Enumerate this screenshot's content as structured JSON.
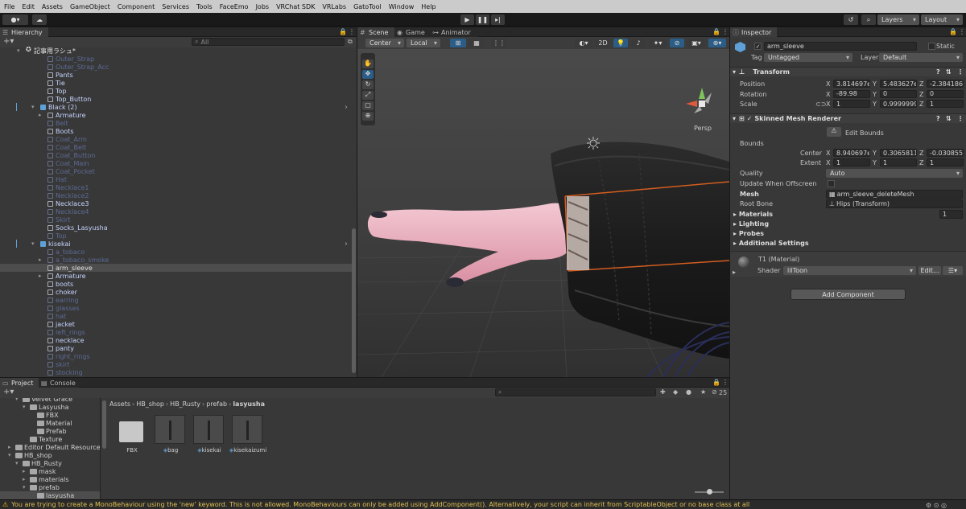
{
  "menu": [
    "File",
    "Edit",
    "Assets",
    "GameObject",
    "Component",
    "Services",
    "Tools",
    "FaceEmo",
    "Jobs",
    "VRChat SDK",
    "VRLabs",
    "GatoTool",
    "Window",
    "Help"
  ],
  "toolbar": {
    "account_label": "",
    "cloud_icon": "cloud-icon",
    "layers": "Layers",
    "layout": "Layout"
  },
  "hierarchy": {
    "tab": "Hierarchy",
    "search_placeholder": "All",
    "rows": [
      {
        "label": "記事用ラシュ*",
        "depth": 0,
        "style": "white",
        "arrow": "▾",
        "icon": "scene"
      },
      {
        "label": "Outer_Strap",
        "depth": 3,
        "style": "dim"
      },
      {
        "label": "Outer_Strap_Acc",
        "depth": 3,
        "style": "dim"
      },
      {
        "label": "Pants",
        "depth": 3,
        "style": "on"
      },
      {
        "label": "Tie",
        "depth": 3,
        "style": "on"
      },
      {
        "label": "Top",
        "depth": 3,
        "style": "on"
      },
      {
        "label": "Top_Button",
        "depth": 3,
        "style": "on"
      },
      {
        "label": "Black (2)",
        "depth": 2,
        "style": "on",
        "arrow": "▾",
        "prefab": true,
        "chevron": true
      },
      {
        "label": "Armature",
        "depth": 3,
        "style": "on",
        "arrow": "▸"
      },
      {
        "label": "Belt",
        "depth": 3,
        "style": "dim"
      },
      {
        "label": "Boots",
        "depth": 3,
        "style": "on"
      },
      {
        "label": "Coat_Arm",
        "depth": 3,
        "style": "dim"
      },
      {
        "label": "Coat_Belt",
        "depth": 3,
        "style": "dim"
      },
      {
        "label": "Coat_Button",
        "depth": 3,
        "style": "dim"
      },
      {
        "label": "Coat_Main",
        "depth": 3,
        "style": "dim"
      },
      {
        "label": "Coat_Pocket",
        "depth": 3,
        "style": "dim"
      },
      {
        "label": "Hat",
        "depth": 3,
        "style": "dim"
      },
      {
        "label": "Necklace1",
        "depth": 3,
        "style": "dim"
      },
      {
        "label": "Necklace2",
        "depth": 3,
        "style": "dim"
      },
      {
        "label": "Necklace3",
        "depth": 3,
        "style": "on"
      },
      {
        "label": "Necklace4",
        "depth": 3,
        "style": "dim"
      },
      {
        "label": "Skirt",
        "depth": 3,
        "style": "dim"
      },
      {
        "label": "Socks_Lasyusha",
        "depth": 3,
        "style": "on"
      },
      {
        "label": "Top",
        "depth": 3,
        "style": "dim"
      },
      {
        "label": "kisekai",
        "depth": 2,
        "style": "on",
        "arrow": "▾",
        "prefab": true,
        "chevron": true
      },
      {
        "label": "a_tobaco",
        "depth": 3,
        "style": "dim"
      },
      {
        "label": "a_tobaco_smoke",
        "depth": 3,
        "style": "dim",
        "arrow": "▸"
      },
      {
        "label": "arm_sleeve",
        "depth": 3,
        "style": "white",
        "selected": true
      },
      {
        "label": "Armature",
        "depth": 3,
        "style": "on",
        "arrow": "▸"
      },
      {
        "label": "boots",
        "depth": 3,
        "style": "on"
      },
      {
        "label": "choker",
        "depth": 3,
        "style": "on"
      },
      {
        "label": "earring",
        "depth": 3,
        "style": "dim"
      },
      {
        "label": "glasses",
        "depth": 3,
        "style": "dim"
      },
      {
        "label": "hat",
        "depth": 3,
        "style": "dim"
      },
      {
        "label": "jacket",
        "depth": 3,
        "style": "on"
      },
      {
        "label": "left_rings",
        "depth": 3,
        "style": "dim"
      },
      {
        "label": "necklace",
        "depth": 3,
        "style": "on"
      },
      {
        "label": "panty",
        "depth": 3,
        "style": "on"
      },
      {
        "label": "right_rings",
        "depth": 3,
        "style": "dim"
      },
      {
        "label": "skirt",
        "depth": 3,
        "style": "dim"
      },
      {
        "label": "stocking",
        "depth": 3,
        "style": "dim"
      }
    ]
  },
  "scene": {
    "tabs": [
      "Scene",
      "Game",
      "Animator"
    ],
    "pivot": "Center",
    "space": "Local",
    "mode_2d": "2D",
    "persp": "Persp",
    "gizmo_axes": [
      "x",
      "y",
      "z"
    ]
  },
  "inspector": {
    "tab": "Inspector",
    "object_name": "arm_sleeve",
    "static_label": "Static",
    "tag_label": "Tag",
    "tag_value": "Untagged",
    "layer_label": "Layer",
    "layer_value": "Default",
    "transform": {
      "title": "Transform",
      "rows": [
        {
          "label": "Position",
          "x": "3.814697e-",
          "y": "5.483627e-",
          "z": "-2.384186e"
        },
        {
          "label": "Rotation",
          "x": "-89.98",
          "y": "0",
          "z": "0"
        },
        {
          "label": "Scale",
          "x": "1",
          "y": "0.9999999",
          "z": "1"
        }
      ]
    },
    "smr": {
      "title": "Skinned Mesh Renderer",
      "edit_bounds": "Edit Bounds",
      "bounds_label": "Bounds",
      "center": {
        "label": "Center",
        "x": "8.940697e-",
        "y": "0.3065811",
        "z": "-0.0308554"
      },
      "extent": {
        "label": "Extent",
        "x": "1",
        "y": "1",
        "z": "1"
      },
      "quality_label": "Quality",
      "quality_value": "Auto",
      "offscreen_label": "Update When Offscreen",
      "mesh_label": "Mesh",
      "mesh_value": "arm_sleeve_deleteMesh",
      "rootbone_label": "Root Bone",
      "rootbone_value": "Hips (Transform)",
      "materials_label": "Materials",
      "materials_count": "1",
      "lighting_label": "Lighting",
      "probes_label": "Probes",
      "additional_label": "Additional Settings"
    },
    "material": {
      "name": "T1 (Material)",
      "shader_label": "Shader",
      "shader_value": "lilToon",
      "edit_label": "Edit..."
    },
    "add_component": "Add Component"
  },
  "project": {
    "tabs": [
      "Project",
      "Console"
    ],
    "search_placeholder": "",
    "count": "25",
    "tree": [
      {
        "label": "Velvet Grace",
        "depth": 1,
        "arrow": "▾"
      },
      {
        "label": "Lasyusha",
        "depth": 2,
        "arrow": "▾"
      },
      {
        "label": "FBX",
        "depth": 3
      },
      {
        "label": "Material",
        "depth": 3
      },
      {
        "label": "Prefab",
        "depth": 3
      },
      {
        "label": "Texture",
        "depth": 2
      },
      {
        "label": "Editor Default Resources",
        "depth": 0,
        "arrow": "▸"
      },
      {
        "label": "HB_shop",
        "depth": 0,
        "arrow": "▾"
      },
      {
        "label": "HB_Rusty",
        "depth": 1,
        "arrow": "▾"
      },
      {
        "label": "mask",
        "depth": 2,
        "arrow": "▸"
      },
      {
        "label": "materials",
        "depth": 2,
        "arrow": "▸"
      },
      {
        "label": "prefab",
        "depth": 2,
        "arrow": "▾"
      },
      {
        "label": "lasyusha",
        "depth": 3,
        "selected": true
      }
    ],
    "breadcrumb": [
      "Assets",
      "HB_shop",
      "HB_Rusty",
      "prefab",
      "lasyusha"
    ],
    "assets": [
      {
        "label": "FBX",
        "kind": "folder"
      },
      {
        "label": "bag",
        "kind": "prefab"
      },
      {
        "label": "kisekai",
        "kind": "prefab"
      },
      {
        "label": "kisekaizumi",
        "kind": "prefab"
      }
    ]
  },
  "status": {
    "message": "You are trying to create a MonoBehaviour using the 'new' keyword.  This is not allowed.  MonoBehaviours can only be added using AddComponent(). Alternatively, your script can inherit from ScriptableObject or no base class at all"
  },
  "colors": {
    "accent": "#2c5d87",
    "selected_row": "#4d4d4d",
    "warning": "#f0c000"
  }
}
